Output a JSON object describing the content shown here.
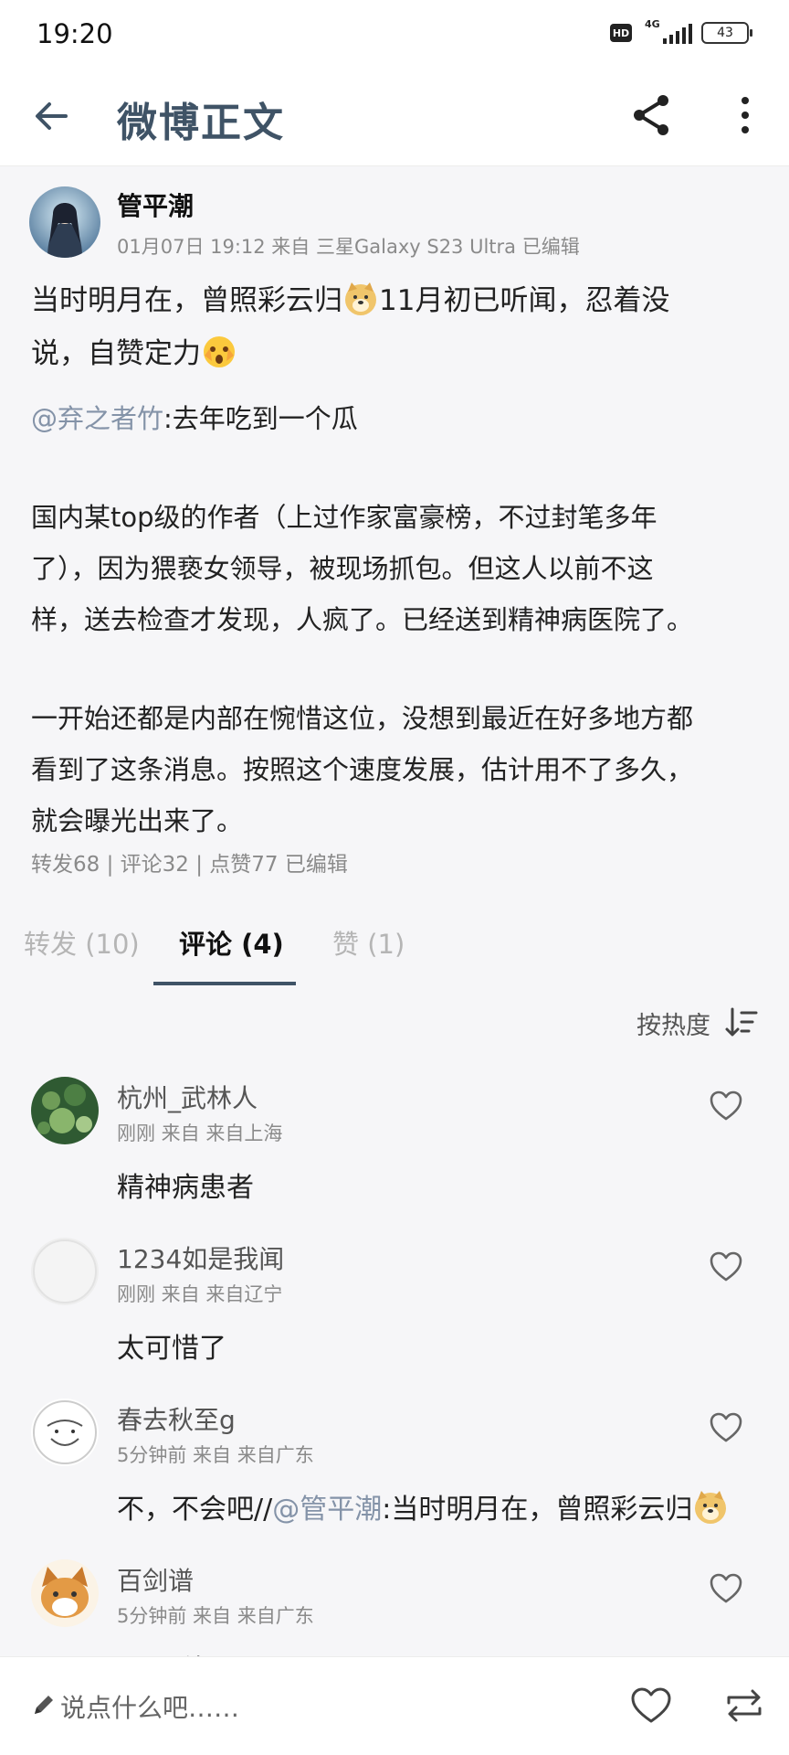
{
  "status_bar": {
    "time": "19:20",
    "hd": "HD",
    "network": "4G",
    "battery": "43"
  },
  "appbar": {
    "title": "微博正文",
    "icons": [
      "back-arrow-icon",
      "share-icon",
      "more-vertical-icon"
    ]
  },
  "post": {
    "author": "管平潮",
    "badges": [
      "verified-icon",
      "crown-icon",
      "membership-icon"
    ],
    "meta": "01月07日 19:12  来自 三星Galaxy S23 Ultra  已编辑",
    "text_1": "当时明月在，曾照彩云归",
    "text_2": "11月初已听闻，忍着没",
    "text_3": "说，自赞定力",
    "repost": {
      "mention": "@弃之者竹",
      "line_1": ":去年吃到一个瓜",
      "para_2_line_1": "国内某top级的作者（上过作家富豪榜，不过封笔多年",
      "para_2_line_2": "了），因为猥亵女领导，被现场抓包。但这人以前不这",
      "para_2_line_3": "样，送去检查才发现，人疯了。已经送到精神病医院了。",
      "para_3_line_1": "一开始还都是内部在惋惜这位，没想到最近在好多地方都",
      "para_3_line_2": "看到了这条消息。按照这个速度发展，估计用不了多久，",
      "para_3_line_3": "就会曝光出来了。"
    },
    "stats": "转发68 | 评论32 | 点赞77  已编辑"
  },
  "tabs": {
    "repost": "转发 (10)",
    "comment": "评论 (4)",
    "like": "赞 (1)",
    "active": "comment"
  },
  "sort": {
    "label": "按热度"
  },
  "comments": [
    {
      "name": "杭州_武林人",
      "meta": "刚刚 来自 来自上海",
      "text": "精神病患者"
    },
    {
      "name": "1234如是我闻",
      "meta": "刚刚 来自 来自辽宁",
      "text": "太可惜了"
    },
    {
      "name": "春去秋至g",
      "meta": "5分钟前 来自 来自广东",
      "text_prefix": "不，不会吧//",
      "mention": "@管平潮",
      "text_suffix": ":当时明月在，曾照彩云归"
    },
    {
      "name": "百剑谱",
      "meta": "5分钟前 来自 来自广东",
      "text": "啊 是他?"
    }
  ],
  "composer": {
    "placeholder": "说点什么吧……"
  },
  "colors": {
    "title": "#3f5366",
    "mention": "#8493a8",
    "muted": "#8a8a8a",
    "background": "#f6f6f8"
  }
}
